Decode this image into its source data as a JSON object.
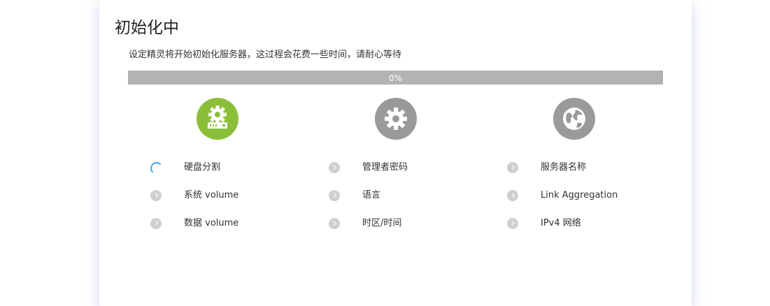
{
  "title": "初始化中",
  "subtitle": "设定精灵将开始初始化服务器，这过程会花费一些时间，请耐心等待",
  "progress": {
    "percent": 0,
    "label": "0%"
  },
  "colors": {
    "accent": "#8bbf3a",
    "inactive": "#9a9a9a",
    "track": "#b3b3b3",
    "spinner": "#4aa3df"
  },
  "columns": [
    {
      "icon": "disk-gear-icon",
      "items": [
        {
          "label": "硬盘分割",
          "state": "in-progress"
        },
        {
          "label": "系统 volume",
          "state": "pending"
        },
        {
          "label": "数据 volume",
          "state": "pending"
        }
      ]
    },
    {
      "icon": "gear-icon",
      "items": [
        {
          "label": "管理者密码",
          "state": "pending"
        },
        {
          "label": "语言",
          "state": "pending"
        },
        {
          "label": "时区/时间",
          "state": "pending"
        }
      ]
    },
    {
      "icon": "globe-icon",
      "items": [
        {
          "label": "服务器名称",
          "state": "pending"
        },
        {
          "label": "Link Aggregation",
          "state": "pending"
        },
        {
          "label": "IPv4 网络",
          "state": "pending"
        }
      ]
    }
  ]
}
